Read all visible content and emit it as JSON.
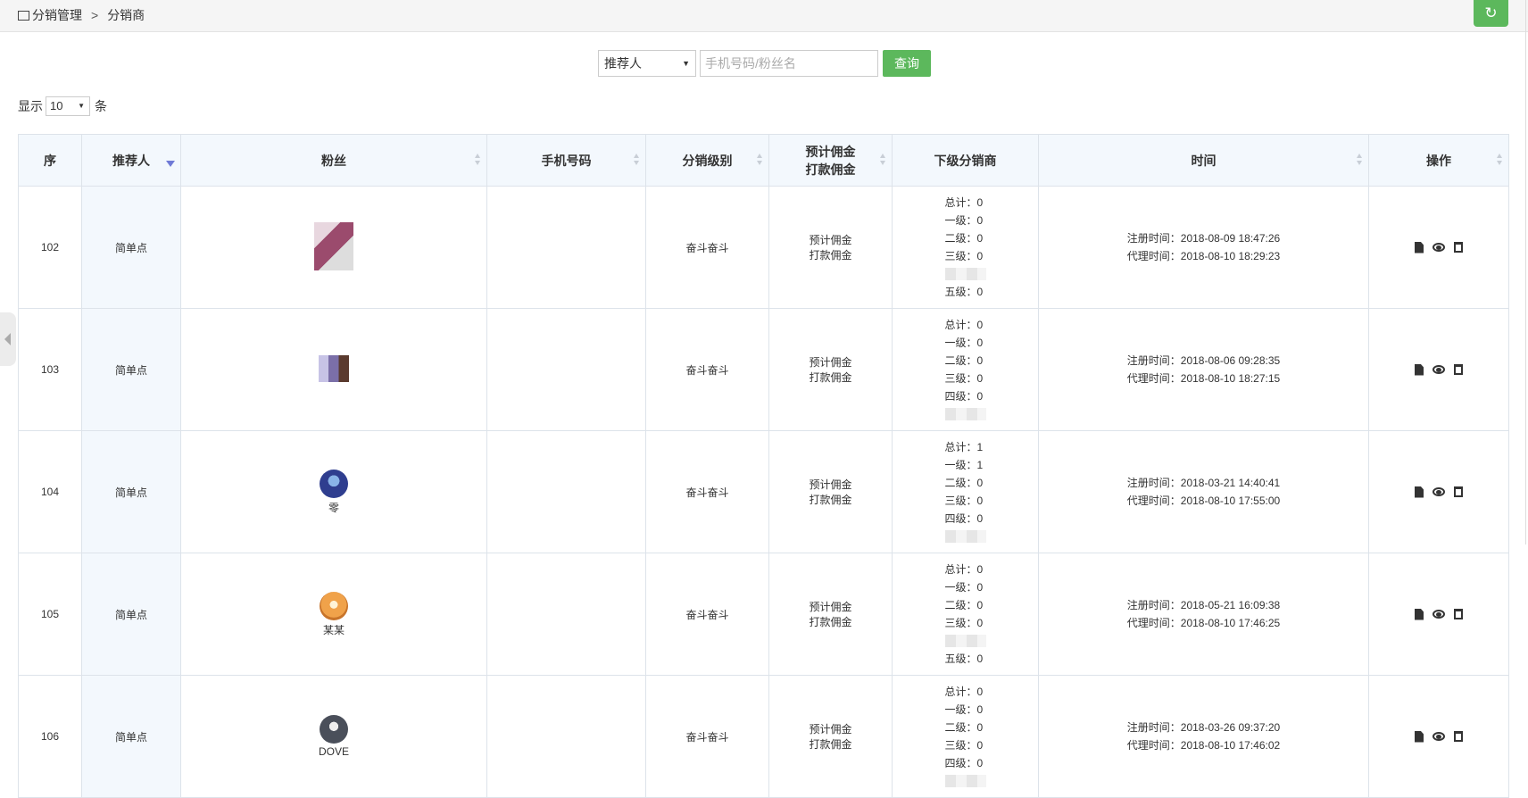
{
  "breadcrumb": {
    "root": "分销管理",
    "separator": ">",
    "current": "分销商"
  },
  "refresh_icon": "refresh-icon",
  "search": {
    "select_value": "推荐人",
    "input_placeholder": "手机号码/粉丝名",
    "button_label": "查询"
  },
  "pager": {
    "prefix": "显示",
    "value": "10",
    "suffix": "条"
  },
  "table": {
    "headers": [
      "序",
      "推荐人",
      "粉丝",
      "手机号码",
      "分销级别",
      "预计佣金",
      "打款佣金",
      "下级分销商",
      "时间",
      "操作"
    ],
    "rows": [
      {
        "id": "102",
        "recommender": "简单点",
        "fan": "",
        "phone": "",
        "level": "奋斗奋斗",
        "commission1": "预计佣金",
        "commission2": "打款佣金",
        "sub": [
          "总计：0",
          "一级：0",
          "二级：0",
          "三级：0",
          "",
          "五级：0"
        ],
        "reg": "注册时间：2018-08-09 18:47:26",
        "agent": "代理时间：2018-08-10 18:29:23"
      },
      {
        "id": "103",
        "recommender": "简单点",
        "fan": "",
        "phone": "",
        "level": "奋斗奋斗",
        "commission1": "预计佣金",
        "commission2": "打款佣金",
        "sub": [
          "总计：0",
          "一级：0",
          "二级：0",
          "三级：0",
          "四级：0",
          ""
        ],
        "reg": "注册时间：2018-08-06 09:28:35",
        "agent": "代理时间：2018-08-10 18:27:15"
      },
      {
        "id": "104",
        "recommender": "简单点",
        "fan": "零",
        "phone": "",
        "level": "奋斗奋斗",
        "commission1": "预计佣金",
        "commission2": "打款佣金",
        "sub": [
          "总计：1",
          "一级：1",
          "二级：0",
          "三级：0",
          "四级：0",
          ""
        ],
        "reg": "注册时间：2018-03-21 14:40:41",
        "agent": "代理时间：2018-08-10 17:55:00"
      },
      {
        "id": "105",
        "recommender": "简单点",
        "fan": "某某",
        "phone": "",
        "level": "奋斗奋斗",
        "commission1": "预计佣金",
        "commission2": "打款佣金",
        "sub": [
          "总计：0",
          "一级：0",
          "二级：0",
          "三级：0",
          "",
          "五级：0"
        ],
        "reg": "注册时间：2018-05-21 16:09:38",
        "agent": "代理时间：2018-08-10 17:46:25"
      },
      {
        "id": "106",
        "recommender": "简单点",
        "fan": "DOVE",
        "phone": "",
        "level": "奋斗奋斗",
        "commission1": "预计佣金",
        "commission2": "打款佣金",
        "sub": [
          "总计：0",
          "一级：0",
          "二级：0",
          "三级：0",
          "四级：0",
          ""
        ],
        "reg": "注册时间：2018-03-26 09:37:20",
        "agent": "代理时间：2018-08-10 17:46:02"
      }
    ]
  },
  "row_icons": [
    "file-icon",
    "view-eye-icon",
    "trash-icon"
  ],
  "colors": {
    "accent": "#5cb85c",
    "header_bg": "#f3f8fd",
    "sort_active": "#6f7ad6"
  }
}
